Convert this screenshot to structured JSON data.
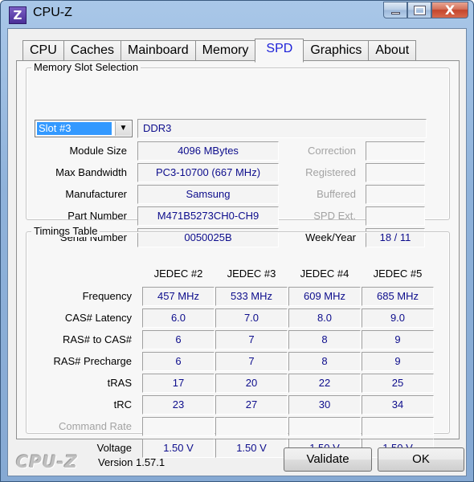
{
  "window": {
    "title": "CPU-Z",
    "app_icon_letter": "Z",
    "close_glyph": "X"
  },
  "tabs": [
    "CPU",
    "Caches",
    "Mainboard",
    "Memory",
    "SPD",
    "Graphics",
    "About"
  ],
  "active_tab": "SPD",
  "slot_section": {
    "title": "Memory Slot Selection",
    "slot_selected": "Slot #3",
    "dropdown_arrow": "▼",
    "memory_type": "DDR3",
    "labels": {
      "module_size": "Module Size",
      "max_bandwidth": "Max Bandwidth",
      "manufacturer": "Manufacturer",
      "part_number": "Part Number",
      "serial_number": "Serial Number",
      "correction": "Correction",
      "registered": "Registered",
      "buffered": "Buffered",
      "spd_ext": "SPD Ext.",
      "week_year": "Week/Year"
    },
    "values": {
      "module_size": "4096 MBytes",
      "max_bandwidth": "PC3-10700 (667 MHz)",
      "manufacturer": "Samsung",
      "part_number": "M471B5273CH0-CH9",
      "serial_number": "0050025B",
      "week_year": "18 / 11"
    }
  },
  "timings": {
    "title": "Timings Table",
    "columns": [
      "JEDEC #2",
      "JEDEC #3",
      "JEDEC #4",
      "JEDEC #5"
    ],
    "rows": [
      {
        "label": "Frequency",
        "values": [
          "457 MHz",
          "533 MHz",
          "609 MHz",
          "685 MHz"
        ]
      },
      {
        "label": "CAS# Latency",
        "values": [
          "6.0",
          "7.0",
          "8.0",
          "9.0"
        ]
      },
      {
        "label": "RAS# to CAS#",
        "values": [
          "6",
          "7",
          "8",
          "9"
        ]
      },
      {
        "label": "RAS# Precharge",
        "values": [
          "6",
          "7",
          "8",
          "9"
        ]
      },
      {
        "label": "tRAS",
        "values": [
          "17",
          "20",
          "22",
          "25"
        ]
      },
      {
        "label": "tRC",
        "values": [
          "23",
          "27",
          "30",
          "34"
        ]
      },
      {
        "label": "Command Rate",
        "values": [
          "",
          "",
          "",
          ""
        ]
      },
      {
        "label": "Voltage",
        "values": [
          "1.50 V",
          "1.50 V",
          "1.50 V",
          "1.50 V"
        ]
      }
    ]
  },
  "footer": {
    "logo": "CPU-Z",
    "version": "Version 1.57.1",
    "validate_label": "Validate",
    "ok_label": "OK"
  }
}
